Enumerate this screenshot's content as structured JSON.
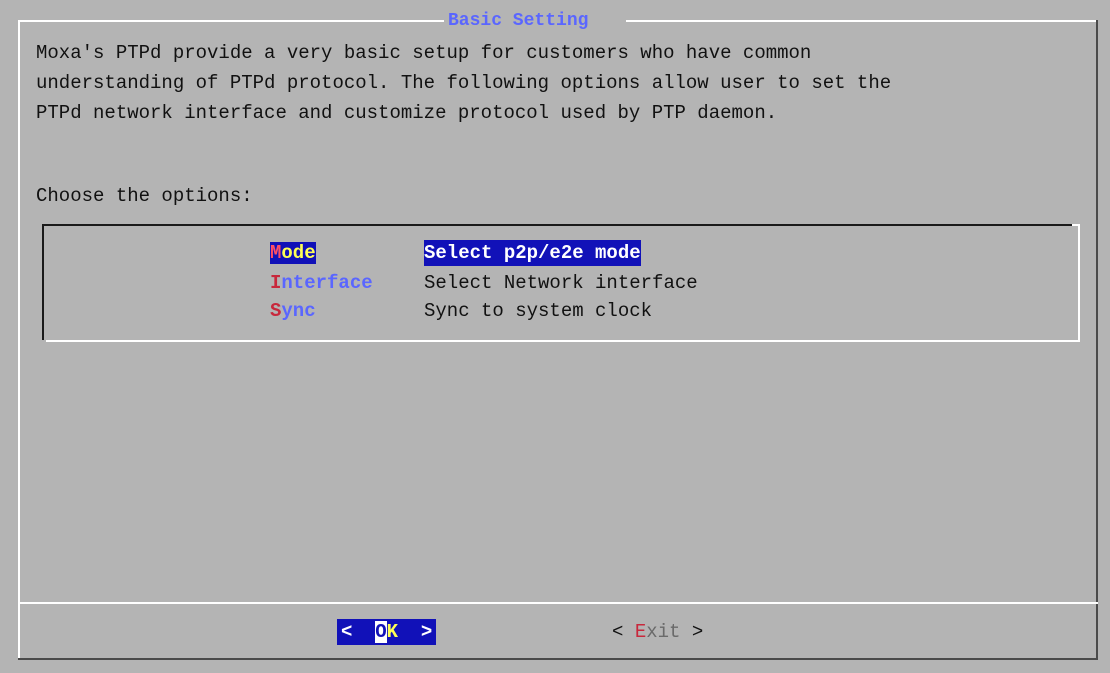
{
  "dialog": {
    "title": "Basic Setting",
    "description": "Moxa's PTPd provide a very basic setup for customers who have common\nunderstanding of PTPd protocol. The following options allow user to set the\nPTPd network interface and customize protocol used by PTP daemon.",
    "prompt": "Choose the options:"
  },
  "menu": {
    "items": [
      {
        "hotkey": "M",
        "tag_rest": "ode",
        "description": "Select p2p/e2e mode",
        "selected": true
      },
      {
        "hotkey": "I",
        "tag_rest": "nterface",
        "description": "Select Network interface",
        "selected": false
      },
      {
        "hotkey": "S",
        "tag_rest": "ync",
        "description": "Sync to system clock",
        "selected": false
      }
    ]
  },
  "buttons": {
    "ok": {
      "left": "<",
      "hotkey": "O",
      "rest": "K",
      "right": ">"
    },
    "exit": {
      "left": "<",
      "hotkey": "E",
      "rest": "xit",
      "right": ">"
    }
  },
  "colors": {
    "background": "#b4b4b4",
    "title": "#5a66ff",
    "selection": "#1111b8",
    "hotkey": "#c8283c",
    "highlight_text": "#ffff55"
  }
}
